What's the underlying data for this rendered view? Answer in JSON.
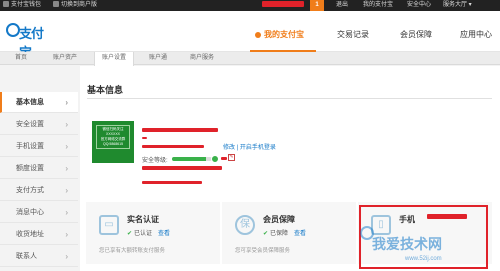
{
  "topbar": {
    "wallet": "支付宝钱包",
    "switch_account": "切换到商户版",
    "message_count": "1",
    "logout": "退出",
    "my_alipay": "我的支付宝",
    "security": "安全中心",
    "service": "服务大厅 ▾"
  },
  "logo": {
    "text": "支付宝"
  },
  "mainnav": [
    "我的支付宝",
    "交易记录",
    "会员保障",
    "应用中心"
  ],
  "subnav": [
    "首页",
    "账户资产",
    "账户设置",
    "账户通",
    "商户服务"
  ],
  "sidebar": [
    {
      "label": "基本信息"
    },
    {
      "label": "安全设置"
    },
    {
      "label": "手机设置"
    },
    {
      "label": "额度设置"
    },
    {
      "label": "支付方式"
    },
    {
      "label": "消息中心"
    },
    {
      "label": "收货地址"
    },
    {
      "label": "联系人"
    }
  ],
  "main": {
    "title": "基本信息",
    "qr_text": [
      "微信扫码关注",
      "XXXXXX",
      "官方网络交流群",
      "QQ:5868615"
    ],
    "links": "修改 | 开启手机登录",
    "security_level_label": "安全等级:",
    "security_level": 0.85
  },
  "infoboxes": [
    {
      "title": "实名认证",
      "status": "已认证",
      "link": "查看",
      "desc": "您已享有大额转账支付服务",
      "icon": "id-card-icon"
    },
    {
      "title": "会员保障",
      "status": "已保障",
      "link": "查看",
      "desc": "您可享受会员保障服务",
      "icon": "shield-icon"
    },
    {
      "title": "手机",
      "status": "",
      "link": "",
      "desc": "",
      "icon": "phone-icon"
    }
  ],
  "watermark": {
    "text": "我爱技术网",
    "url": "www.52ij.com"
  },
  "colors": {
    "accent": "#f07d1a",
    "brand": "#1479c8",
    "redaction": "#e0222a",
    "success": "#3ab14a"
  }
}
